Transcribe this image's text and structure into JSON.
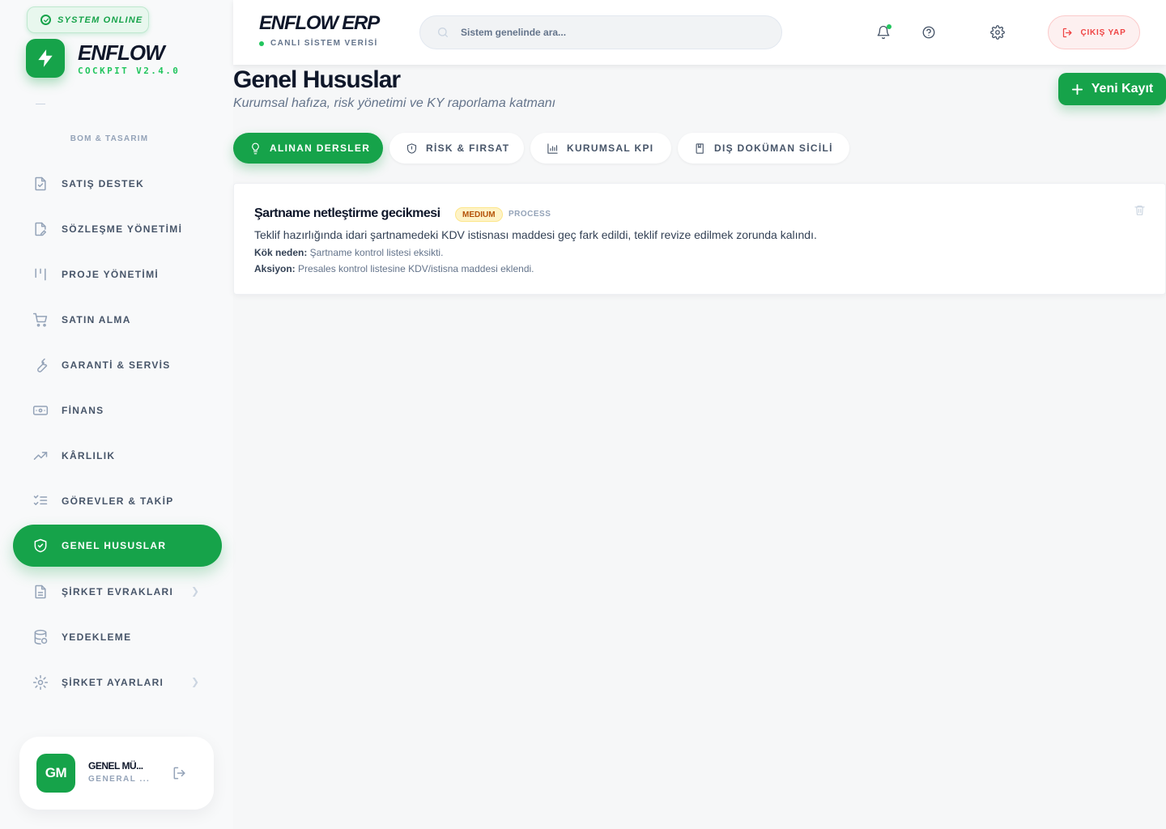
{
  "sidebar": {
    "status": "SYSTEM ONLINE",
    "app_name": "ENFLOW",
    "app_version": "COCKPIT V2.4.0",
    "section_title": "BOM & TASARIM",
    "items": [
      {
        "label": "SATIŞ DESTEK",
        "icon": "file-check-icon"
      },
      {
        "label": "SÖZLEŞME YÖNETİMİ",
        "icon": "file-edit-icon"
      },
      {
        "label": "PROJE YÖNETİMİ",
        "icon": "kanban-icon"
      },
      {
        "label": "SATIN ALMA",
        "icon": "cart-icon"
      },
      {
        "label": "GARANTİ & SERVİS",
        "icon": "wrench-icon"
      },
      {
        "label": "FİNANS",
        "icon": "banknote-icon"
      },
      {
        "label": "KÂRLILIK",
        "icon": "trending-up-icon"
      },
      {
        "label": "GÖREVLER & TAKİP",
        "icon": "checklist-icon"
      },
      {
        "label": "GENEL HUSUSLAR",
        "icon": "shield-check-icon",
        "active": true
      },
      {
        "label": "ŞİRKET EVRAKLARI",
        "icon": "document-icon",
        "chevron": true
      },
      {
        "label": "YEDEKLEME",
        "icon": "database-backup-icon"
      },
      {
        "label": "ŞİRKET AYARLARI",
        "icon": "gear-icon",
        "chevron": true
      }
    ],
    "user": {
      "initials": "GM",
      "name": "GENEL MÜ...",
      "role": "GENERAL ..."
    }
  },
  "header": {
    "brand": "ENFLOW ERP",
    "brand_sub": "CANLI SİSTEM VERİSİ",
    "search_placeholder": "Sistem genelinde ara...",
    "exit_label": "ÇIKIŞ YAP"
  },
  "main": {
    "title": "Genel Hususlar",
    "subtitle": "Kurumsal hafıza, risk yönetimi ve KY raporlama katmanı",
    "new_button": "Yeni Kayıt",
    "tabs": [
      {
        "label": "ALINAN DERSLER",
        "icon": "lightbulb-icon",
        "active": true
      },
      {
        "label": "RİSK & FIRSAT",
        "icon": "shield-icon"
      },
      {
        "label": "KURUMSAL KPI",
        "icon": "bar-chart-icon"
      },
      {
        "label": "DIŞ DOKÜMAN SİCİLİ",
        "icon": "book-icon"
      }
    ],
    "records": [
      {
        "title": "Şartname netleştirme gecikmesi",
        "severity": "MEDIUM",
        "category": "PROCESS",
        "description": "Teklif hazırlığında idari şartnamedeki KDV istisnası maddesi geç fark edildi, teklif revize edilmek zorunda kalındı.",
        "root_cause_label": "Kök neden:",
        "root_cause": " Şartname kontrol listesi eksikti.",
        "action_label": "Aksiyon:",
        "action": " Presales kontrol listesine KDV/istisna maddesi eklendi."
      }
    ]
  },
  "colors": {
    "accent": "#16a34a",
    "danger": "#ef4444",
    "warning_bg": "#fef3c7",
    "warning_text": "#b45309"
  }
}
